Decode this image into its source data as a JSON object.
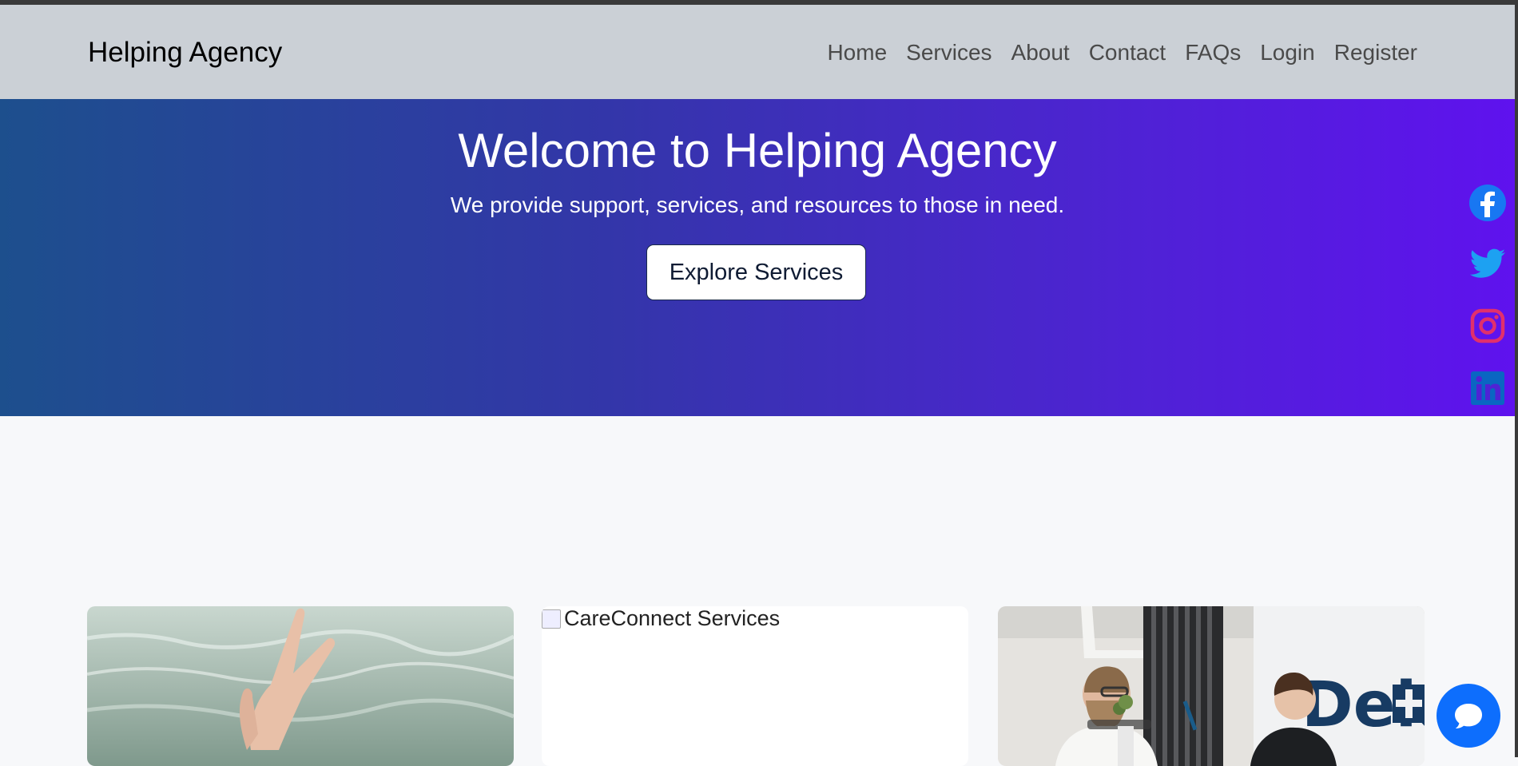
{
  "navbar": {
    "brand": "Helping Agency",
    "links": [
      "Home",
      "Services",
      "About",
      "Contact",
      "FAQs",
      "Login",
      "Register"
    ]
  },
  "hero": {
    "title": "Welcome to Helping Agency",
    "subtitle": "We provide support, services, and resources to those in need.",
    "button_label": "Explore Services"
  },
  "social": [
    {
      "icon": "facebook-icon",
      "color": "#1877f2"
    },
    {
      "icon": "twitter-icon",
      "color": "#1da1f2"
    },
    {
      "icon": "instagram-icon",
      "color": "#e1306c"
    },
    {
      "icon": "linkedin-icon",
      "color": "#0a66c2"
    }
  ],
  "cards": [
    {
      "alt": "",
      "image": "hand-in-water-photo"
    },
    {
      "alt": "CareConnect Services",
      "image": "broken-image"
    },
    {
      "alt": "",
      "image": "office-meeting-photo"
    }
  ],
  "chat": {
    "icon": "chat-bubble-icon",
    "color": "#0d6efd"
  }
}
